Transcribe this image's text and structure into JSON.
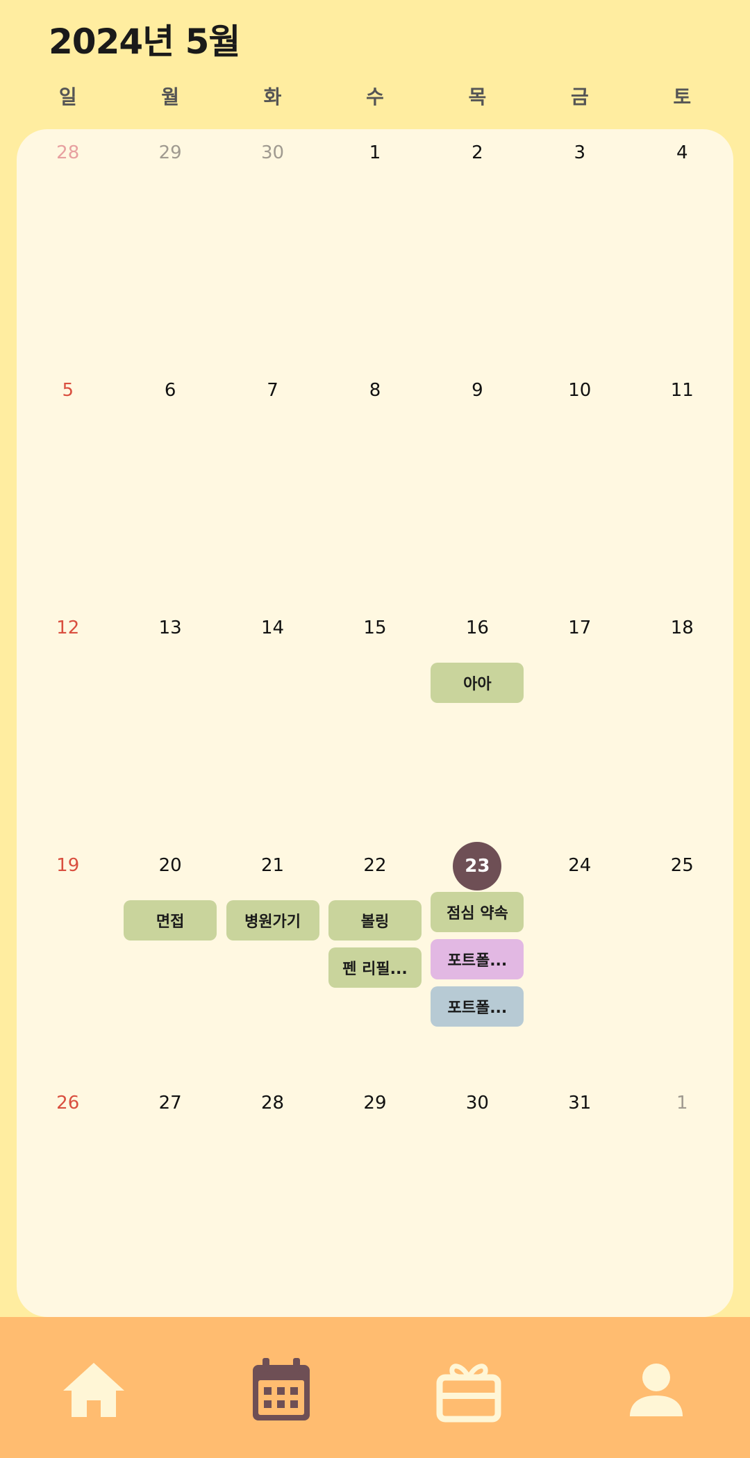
{
  "header": {
    "title": "2024년 5월"
  },
  "weekdays": [
    "일",
    "월",
    "화",
    "수",
    "목",
    "금",
    "토"
  ],
  "weeks": [
    [
      {
        "day": "28",
        "muted": true,
        "sunday": true
      },
      {
        "day": "29",
        "muted": true
      },
      {
        "day": "30",
        "muted": true
      },
      {
        "day": "1"
      },
      {
        "day": "2"
      },
      {
        "day": "3"
      },
      {
        "day": "4"
      }
    ],
    [
      {
        "day": "5",
        "sunday": true
      },
      {
        "day": "6"
      },
      {
        "day": "7"
      },
      {
        "day": "8"
      },
      {
        "day": "9"
      },
      {
        "day": "10"
      },
      {
        "day": "11"
      }
    ],
    [
      {
        "day": "12",
        "sunday": true
      },
      {
        "day": "13"
      },
      {
        "day": "14"
      },
      {
        "day": "15"
      },
      {
        "day": "16",
        "events": [
          {
            "title": "아아",
            "color": "#C9D49C"
          }
        ]
      },
      {
        "day": "17"
      },
      {
        "day": "18"
      }
    ],
    [
      {
        "day": "19",
        "sunday": true
      },
      {
        "day": "20",
        "events": [
          {
            "title": "면접",
            "color": "#C9D49C"
          }
        ]
      },
      {
        "day": "21",
        "events": [
          {
            "title": "병원가기",
            "color": "#C9D49C"
          }
        ]
      },
      {
        "day": "22",
        "events": [
          {
            "title": "볼링",
            "color": "#C9D49C"
          },
          {
            "title": "펜 리필...",
            "color": "#C9D49C"
          }
        ]
      },
      {
        "day": "23",
        "today": true,
        "events": [
          {
            "title": "점심 약속",
            "color": "#C9D49C"
          },
          {
            "title": "포트폴...",
            "color": "#E2B8E3"
          },
          {
            "title": "포트폴...",
            "color": "#B7CAD4"
          }
        ]
      },
      {
        "day": "24"
      },
      {
        "day": "25"
      }
    ],
    [
      {
        "day": "26",
        "sunday": true
      },
      {
        "day": "27"
      },
      {
        "day": "28"
      },
      {
        "day": "29"
      },
      {
        "day": "30"
      },
      {
        "day": "31"
      },
      {
        "day": "1",
        "muted": true
      }
    ]
  ],
  "colors": {
    "background": "#FFEDA0",
    "calendar_panel": "#FFF8E1",
    "sunday_text": "#D94F3F",
    "today_circle": "#6E4F55",
    "nav_bar": "#FFBC70",
    "nav_icon_inactive": "#FFF6D6",
    "nav_icon_active": "#6E4F55"
  },
  "nav": [
    {
      "name": "home-icon",
      "active": false
    },
    {
      "name": "calendar-icon",
      "active": true
    },
    {
      "name": "gift-icon",
      "active": false
    },
    {
      "name": "profile-icon",
      "active": false
    }
  ]
}
